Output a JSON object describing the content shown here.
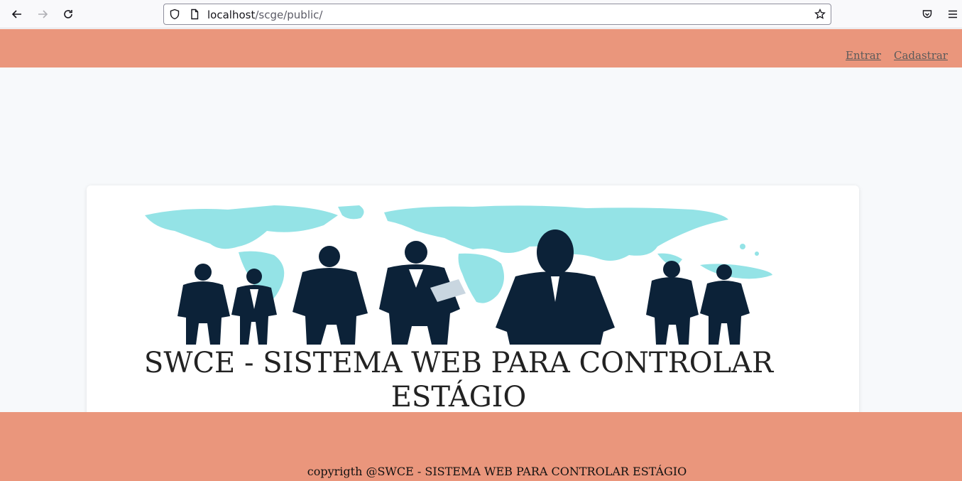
{
  "browser": {
    "url_host": "localhost",
    "url_path": "/scge/public/",
    "icons": [
      "back-icon",
      "forward-icon",
      "reload-icon",
      "shield-icon",
      "page-icon",
      "star-icon",
      "pocket-icon",
      "menu-icon"
    ]
  },
  "header": {
    "links": [
      {
        "label": "Entrar"
      },
      {
        "label": "Cadastrar"
      }
    ]
  },
  "main": {
    "title": "SWCE - SISTEMA WEB PARA CONTROLAR ESTÁGIO"
  },
  "footer": {
    "text": "copyrigth @SWCE - SISTEMA WEB PARA CONTROLAR ESTÁGIO"
  },
  "colors": {
    "header_bg": "#ea967c",
    "page_bg": "#f7f9fb",
    "map": "#94e3e6",
    "silhouette": "#0c2238"
  }
}
